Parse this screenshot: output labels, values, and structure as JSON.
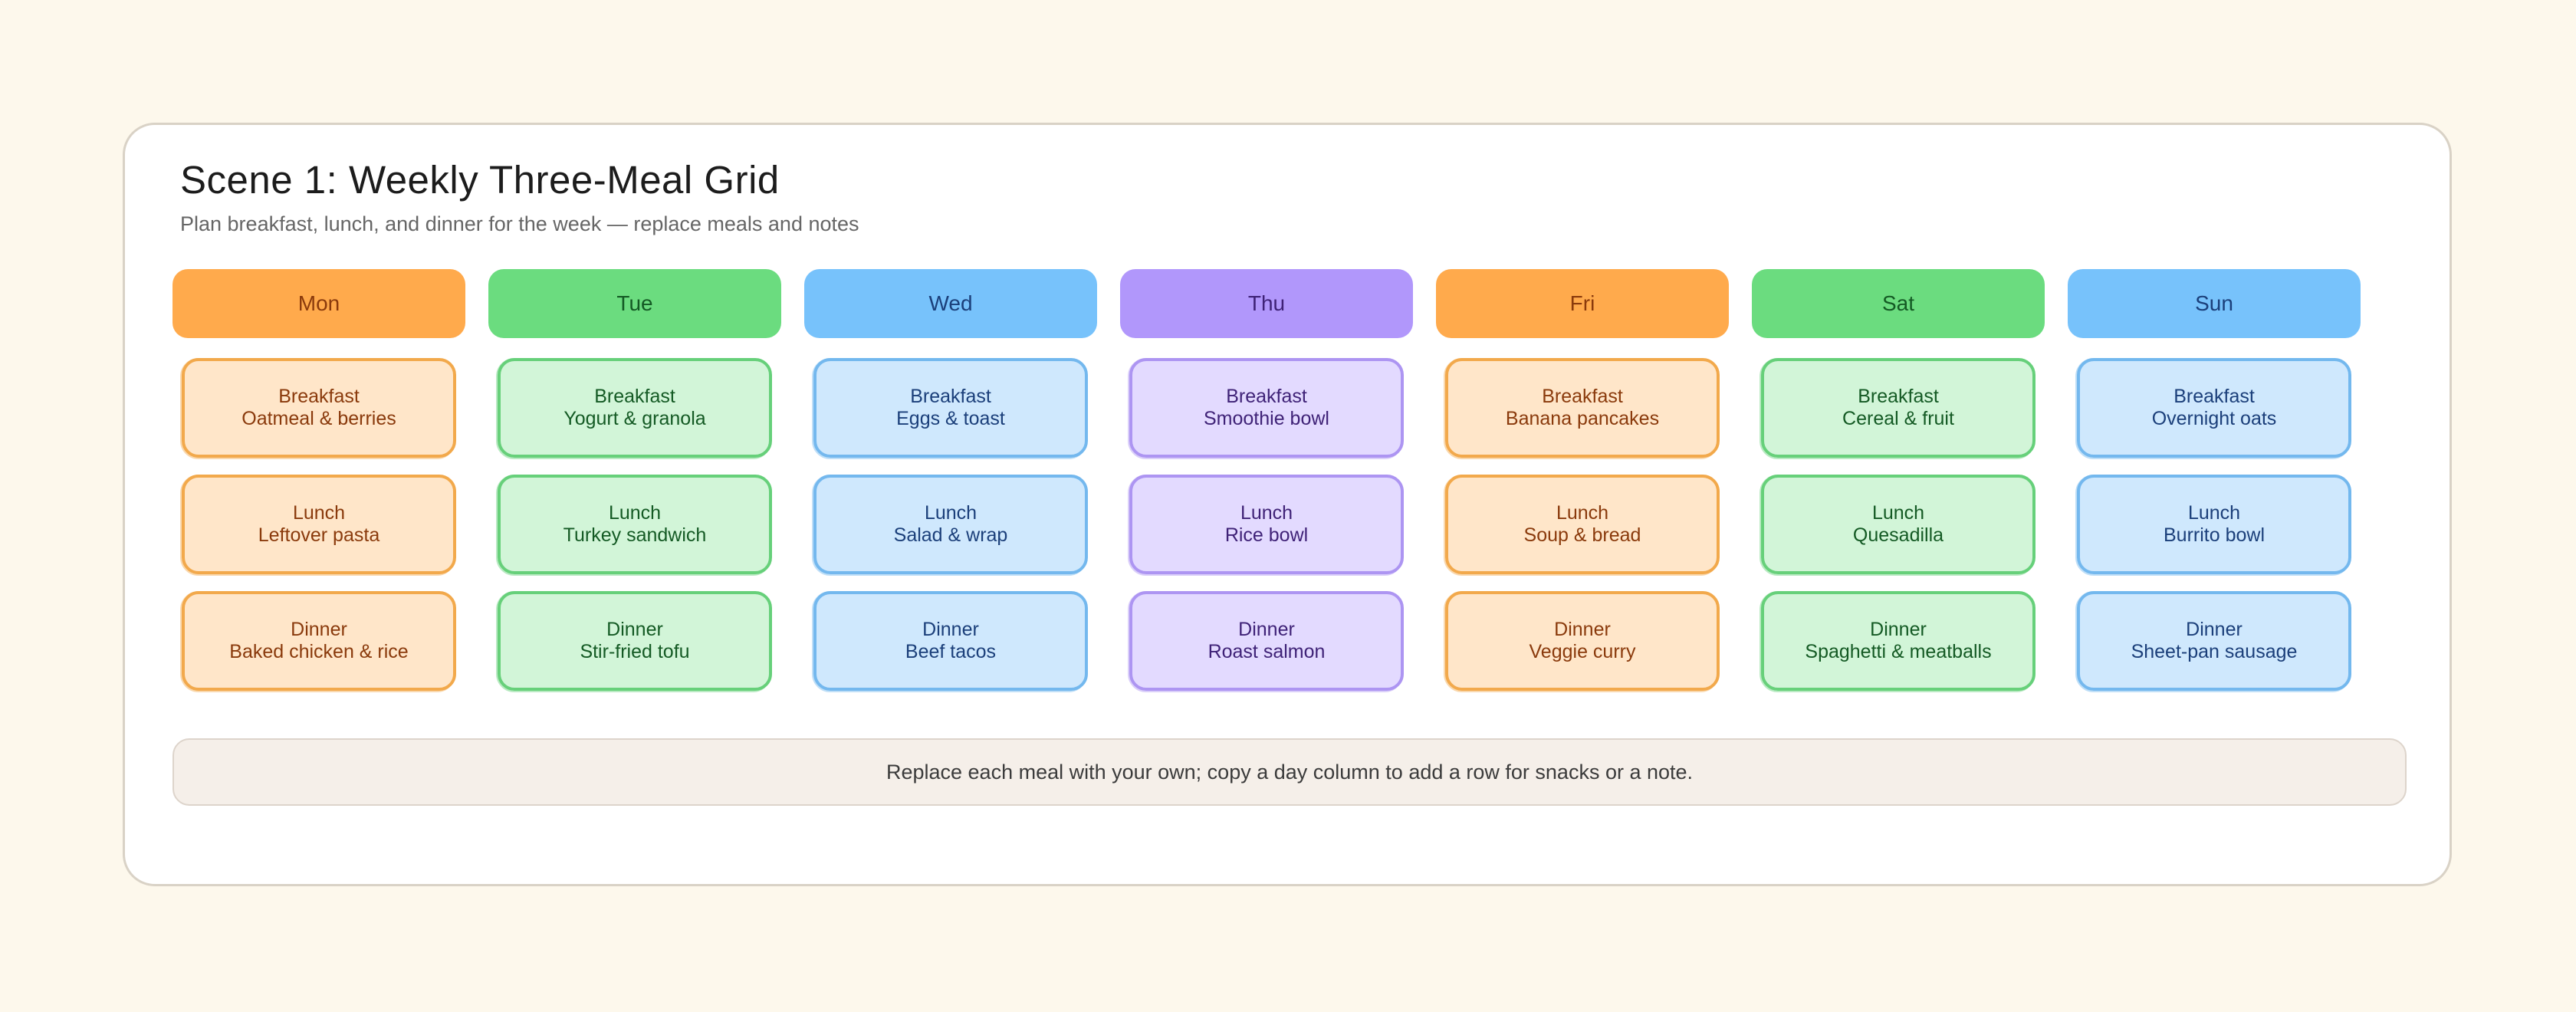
{
  "scene": {
    "title": "Scene 1: Weekly Three-Meal Grid",
    "subtitle": "Plan breakfast, lunch, and dinner for the week — replace meals and notes"
  },
  "palette": {
    "orange": {
      "header": "#ffaa4c",
      "header_text": "#8a3a0c",
      "fill": "#ffe6c9",
      "border": "#f2a94c",
      "text": "#8a3a0c"
    },
    "green": {
      "header": "#6bdc7f",
      "header_text": "#145a24",
      "fill": "#d2f5d8",
      "border": "#67d07a",
      "text": "#145a24"
    },
    "blue": {
      "header": "#77c2fb",
      "header_text": "#1b3f7a",
      "fill": "#cfe8fd",
      "border": "#74b8ee",
      "text": "#1b3f7a"
    },
    "purple": {
      "header": "#b197fb",
      "header_text": "#3f2277",
      "fill": "#e3daff",
      "border": "#ad95f2",
      "text": "#3f2277"
    }
  },
  "days": [
    {
      "name": "Mon",
      "color": "orange",
      "meals": [
        {
          "label": "Breakfast",
          "item": "Oatmeal & berries"
        },
        {
          "label": "Lunch",
          "item": "Leftover pasta"
        },
        {
          "label": "Dinner",
          "item": "Baked chicken & rice"
        }
      ]
    },
    {
      "name": "Tue",
      "color": "green",
      "meals": [
        {
          "label": "Breakfast",
          "item": "Yogurt & granola"
        },
        {
          "label": "Lunch",
          "item": "Turkey sandwich"
        },
        {
          "label": "Dinner",
          "item": "Stir-fried tofu"
        }
      ]
    },
    {
      "name": "Wed",
      "color": "blue",
      "meals": [
        {
          "label": "Breakfast",
          "item": "Eggs & toast"
        },
        {
          "label": "Lunch",
          "item": "Salad & wrap"
        },
        {
          "label": "Dinner",
          "item": "Beef tacos"
        }
      ]
    },
    {
      "name": "Thu",
      "color": "purple",
      "meals": [
        {
          "label": "Breakfast",
          "item": "Smoothie bowl"
        },
        {
          "label": "Lunch",
          "item": "Rice bowl"
        },
        {
          "label": "Dinner",
          "item": "Roast salmon"
        }
      ]
    },
    {
      "name": "Fri",
      "color": "orange",
      "meals": [
        {
          "label": "Breakfast",
          "item": "Banana pancakes"
        },
        {
          "label": "Lunch",
          "item": "Soup & bread"
        },
        {
          "label": "Dinner",
          "item": "Veggie curry"
        }
      ]
    },
    {
      "name": "Sat",
      "color": "green",
      "meals": [
        {
          "label": "Breakfast",
          "item": "Cereal & fruit"
        },
        {
          "label": "Lunch",
          "item": "Quesadilla"
        },
        {
          "label": "Dinner",
          "item": "Spaghetti & meatballs"
        }
      ]
    },
    {
      "name": "Sun",
      "color": "blue",
      "meals": [
        {
          "label": "Breakfast",
          "item": "Overnight oats"
        },
        {
          "label": "Lunch",
          "item": "Burrito bowl"
        },
        {
          "label": "Dinner",
          "item": "Sheet-pan sausage"
        }
      ]
    }
  ],
  "footer": {
    "note": "Replace each meal with your own; copy a day column to add a row for snacks or a note."
  }
}
